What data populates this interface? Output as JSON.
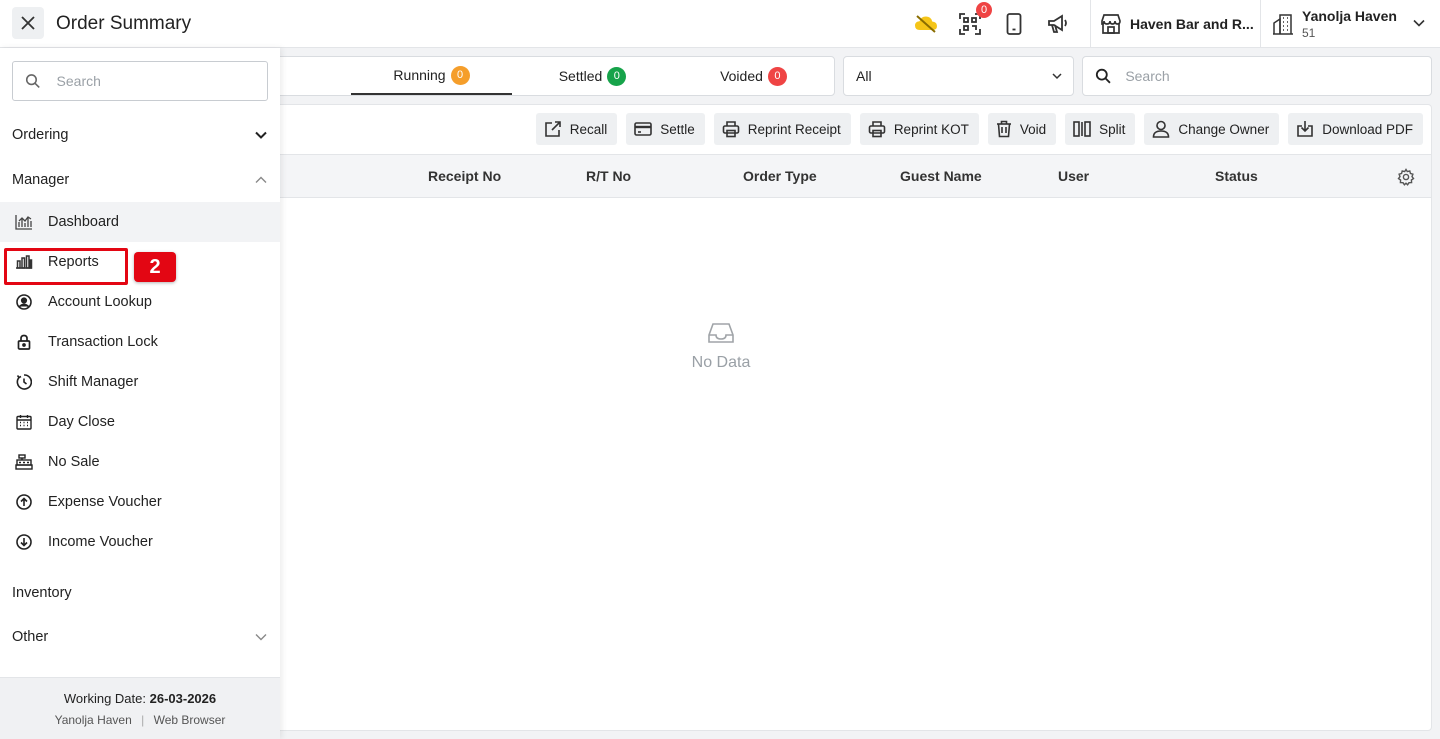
{
  "header": {
    "title": "Order Summary",
    "notification_count": "0",
    "venue_name": "Haven Bar and R...",
    "property_name": "Yanolja Haven",
    "property_number": "51"
  },
  "colors": {
    "orange": "#f59e2b",
    "green": "#16a34a",
    "red": "#ef4444",
    "highlight": "#e30613"
  },
  "tabs": [
    {
      "label": "Running",
      "count": "0",
      "color": "orange",
      "active": true
    },
    {
      "label": "Settled",
      "count": "0",
      "color": "green",
      "active": false
    },
    {
      "label": "Voided",
      "count": "0",
      "color": "red",
      "active": false
    }
  ],
  "filter": {
    "selected": "All"
  },
  "search": {
    "placeholder": "Search"
  },
  "toolbar": {
    "recall": "Recall",
    "settle": "Settle",
    "reprint_receipt": "Reprint Receipt",
    "reprint_kot": "Reprint KOT",
    "void": "Void",
    "split": "Split",
    "change_owner": "Change Owner",
    "download_pdf": "Download PDF"
  },
  "table": {
    "columns": [
      "Receipt No",
      "R/T No",
      "Order Type",
      "Guest Name",
      "User",
      "Status"
    ],
    "empty_text": "No Data"
  },
  "sidebar": {
    "search_placeholder": "Search",
    "groups": {
      "ordering": "Ordering",
      "manager": "Manager",
      "inventory": "Inventory",
      "other": "Other"
    },
    "items": [
      {
        "label": "Dashboard",
        "icon": "dashboard-chart-icon"
      },
      {
        "label": "Reports",
        "icon": "bar-chart-icon"
      },
      {
        "label": "Account Lookup",
        "icon": "user-circle-icon"
      },
      {
        "label": "Transaction Lock",
        "icon": "lock-icon"
      },
      {
        "label": "Shift Manager",
        "icon": "clock-icon"
      },
      {
        "label": "Day Close",
        "icon": "calendar-icon"
      },
      {
        "label": "No Sale",
        "icon": "register-icon"
      },
      {
        "label": "Expense Voucher",
        "icon": "arrow-up-circle-icon"
      },
      {
        "label": "Income Voucher",
        "icon": "arrow-down-circle-icon"
      }
    ],
    "step_badge": "2",
    "footer": {
      "working_date_label": "Working Date:",
      "working_date": "26-03-2026",
      "property": "Yanolja Haven",
      "separator": "|",
      "platform": "Web Browser"
    }
  }
}
